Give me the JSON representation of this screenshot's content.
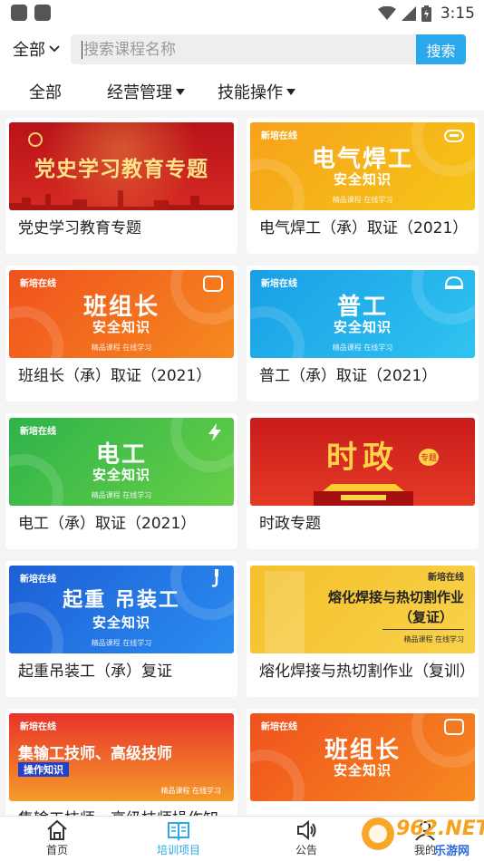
{
  "status_bar": {
    "time": "3:15"
  },
  "search": {
    "scope_label": "全部",
    "placeholder": "搜索课程名称",
    "button_label": "搜索"
  },
  "filters": [
    {
      "label": "全部"
    },
    {
      "label": "经营管理"
    },
    {
      "label": "技能操作"
    }
  ],
  "courses": [
    {
      "title": "党史学习教育专题",
      "thumb_main": "党史学习教育专题",
      "colors": [
        "#c8161d",
        "#e63a2a"
      ]
    },
    {
      "title": "电气焊工（承）取证（2021）",
      "thumb_brand": "新培在线",
      "thumb_main": "电气焊工",
      "thumb_sub": "安全知识",
      "thumb_foot": "精品课程 在线学习",
      "colors": [
        "#f7a21b",
        "#f5c518"
      ]
    },
    {
      "title": "班组长（承）取证（2021）",
      "thumb_brand": "新培在线",
      "thumb_main": "班组长",
      "thumb_sub": "安全知识",
      "thumb_foot": "精品课程 在线学习",
      "colors": [
        "#f0521e",
        "#f68a1f"
      ]
    },
    {
      "title": "普工（承）取证（2021）",
      "thumb_brand": "新培在线",
      "thumb_main": "普工",
      "thumb_sub": "安全知识",
      "thumb_foot": "精品课程 在线学习",
      "colors": [
        "#1a9fe6",
        "#2fc4f0"
      ]
    },
    {
      "title": "电工（承）取证（2021）",
      "thumb_brand": "新培在线",
      "thumb_main": "电工",
      "thumb_sub": "安全知识",
      "thumb_foot": "精品课程 在线学习",
      "colors": [
        "#2fb34a",
        "#67cf47"
      ]
    },
    {
      "title": "时政专题",
      "thumb_main": "时政",
      "thumb_tag": "专题",
      "colors": [
        "#c91c1c",
        "#e43a26"
      ]
    },
    {
      "title": "起重吊装工（承）复证",
      "thumb_brand": "新培在线",
      "thumb_main": "起重 吊装工",
      "thumb_sub": "安全知识",
      "thumb_foot": "精品课程 在线学习",
      "colors": [
        "#1d5fd6",
        "#2b8df0"
      ]
    },
    {
      "title": "熔化焊接与热切割作业（复训）",
      "thumb_brand": "新培在线",
      "thumb_main": "熔化焊接与热切割作业",
      "thumb_sub": "（复证）",
      "thumb_foot": "精品课程 在线学习",
      "colors": [
        "#f5c02a",
        "#f8d24a"
      ]
    },
    {
      "title": "集输工技师、高级技师操作知",
      "thumb_brand": "新培在线",
      "thumb_main": "集输工技师、高级技师",
      "thumb_sub": "操作知识",
      "thumb_foot": "精品课程 在线学习",
      "colors": [
        "#e8332a",
        "#f59b2a"
      ]
    },
    {
      "title": "",
      "thumb_brand": "新培在线",
      "thumb_main": "班组长",
      "thumb_sub": "安全知识",
      "thumb_foot": "",
      "colors": [
        "#f0521e",
        "#f68a1f"
      ]
    }
  ],
  "bottom_nav": [
    {
      "label": "首页",
      "icon": "home-icon"
    },
    {
      "label": "培训项目",
      "icon": "book-icon",
      "active": true
    },
    {
      "label": "公告",
      "icon": "speaker-icon"
    },
    {
      "label": "我的",
      "icon": "user-icon"
    }
  ],
  "watermark": {
    "text": "962.NET",
    "sub": "乐游网"
  },
  "colors": {
    "accent": "#29a9ec",
    "text": "#222222",
    "background": "#f4f4f4"
  }
}
